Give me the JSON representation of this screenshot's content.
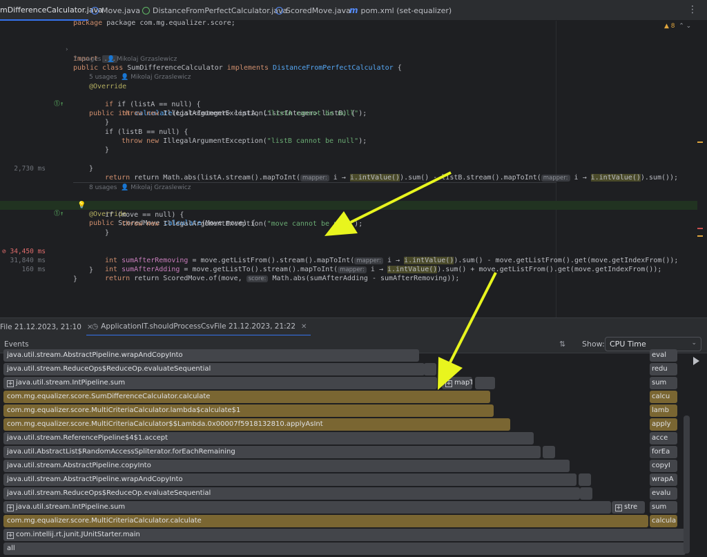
{
  "tabs": [
    {
      "label": "mDifferenceCalculator.java",
      "icon": "class-icon",
      "active": true
    },
    {
      "label": "Move.java",
      "icon": "class-icon"
    },
    {
      "label": "DistanceFromPerfectCalculator.java",
      "icon": "interface-icon"
    },
    {
      "label": "ScoredMove.java",
      "icon": "record-icon"
    },
    {
      "label": "pom.xml (set-equalizer)",
      "icon": "maven-icon"
    }
  ],
  "tabs_more": "⋮",
  "editor": {
    "warning_count": "8",
    "package_line": "package com.mg.equalizer.score;",
    "import_kw": "import",
    "import_fold": "...",
    "hint1_usages": "7 usages",
    "hint1_author": "Mikolaj Grzaslewicz",
    "class_kw": "public class",
    "class_name": "SumDifferenceCalculator",
    "implements_kw": "implements",
    "iface_name": "DistanceFromPerfectCalculator",
    "open_brace": "{",
    "hint2_usages": "5 usages",
    "hint2_author": "Mikolaj Grzaslewicz",
    "override1": "@Override",
    "m1_kw": "public int",
    "m1_name": "calculate",
    "m1_params": "(List<Integer> listA, List<Integer> listB) {",
    "if_a": "if (listA == null) {",
    "throw_a_kw": "throw new",
    "throw_a_cls": "IllegalArgumentException(",
    "throw_a_str": "\"listA cannot be null\"",
    "throw_end": ");",
    "close": "}",
    "if_b": "if (listB == null) {",
    "throw_b_str": "\"listB cannot be null\"",
    "return1_a": "return Math.abs(listA.stream().mapToInt(",
    "mapper": "mapper:",
    "lambda_var": "i → ",
    "int_value": "i.intValue()",
    "return1_b": ").sum() - listB.stream().mapToInt(",
    "return1_c": ").sum());",
    "ms_return1": "2,730 ms",
    "hint3_usages": "8 usages",
    "hint3_author": "Mikolaj Grzaslewicz",
    "override2": "@Override",
    "m2_kw": "public",
    "m2_type": "ScoredMove",
    "m2_name": "calculate",
    "m2_params": "(Move move) {",
    "if_move": "if (move == null) {",
    "throw_move_str": "\"move cannot be null\"",
    "int_kw": "int",
    "removing_var": "sumAfterRemoving",
    "removing_a": " = move.getListFrom().stream().mapToInt(",
    "removing_b": ").sum() - move.getListFrom().get(move.getIndexFrom());",
    "adding_var": "sumAfterAdding",
    "adding_a": " = move.getListTo().stream().mapToInt(",
    "adding_b": ").sum() + move.getListFrom().get(move.getIndexFrom());",
    "return2_a": "return ScoredMove.of(move, ",
    "score": "score:",
    "return2_b": "Math.abs(sumAfterAdding - sumAfterRemoving));",
    "ms_removing": "34,450 ms",
    "ms_adding": "31,840 ms",
    "ms_return2": "160 ms"
  },
  "profiler": {
    "tab1": "File 21.12.2023, 21:10",
    "tab2": "ApplicationIT.shouldProcessCsvFile 21.12.2023, 21:22",
    "close_x": "✕",
    "events_label": "Events",
    "show_label": "Show:",
    "show_value": "CPU Time",
    "frames": [
      {
        "label": "java.util.stream.AbstractPipeline.wrapAndCopyInto",
        "color": "gray",
        "side": "eval"
      },
      {
        "label": "java.util.stream.ReduceOps$ReduceOp.evaluateSequential",
        "color": "gray",
        "side": "redu"
      },
      {
        "label": "java.util.stream.IntPipeline.sum",
        "color": "gray",
        "expand": true,
        "extra": "mapTo",
        "side": "sum"
      },
      {
        "label": "com.mg.equalizer.score.SumDifferenceCalculator.calculate",
        "color": "gold",
        "side": "calcu"
      },
      {
        "label": "com.mg.equalizer.score.MultiCriteriaCalculator.lambda$calculate$1",
        "color": "gold",
        "side": "lamb"
      },
      {
        "label": "com.mg.equalizer.score.MultiCriteriaCalculator$$Lambda.0x00007f5918132810.applyAsInt",
        "color": "gold",
        "side": "apply"
      },
      {
        "label": "java.util.stream.ReferencePipeline$4$1.accept",
        "color": "gray",
        "side": "acce"
      },
      {
        "label": "java.util.AbstractList$RandomAccessSpliterator.forEachRemaining",
        "color": "gray",
        "side": "forEa"
      },
      {
        "label": "java.util.stream.AbstractPipeline.copyInto",
        "color": "gray",
        "side": "copyI"
      },
      {
        "label": "java.util.stream.AbstractPipeline.wrapAndCopyInto",
        "color": "gray",
        "side": "wrapA"
      },
      {
        "label": "java.util.stream.ReduceOps$ReduceOp.evaluateSequential",
        "color": "gray",
        "side": "evalu"
      },
      {
        "label": "java.util.stream.IntPipeline.sum",
        "color": "gray",
        "expand": true,
        "extra": "stre",
        "side": "sum"
      },
      {
        "label": "com.mg.equalizer.score.MultiCriteriaCalculator.calculate",
        "color": "gold",
        "side": "calcula"
      },
      {
        "label": "com.intellij.rt.junit.JUnitStarter.main",
        "color": "gray",
        "expand": true
      },
      {
        "label": "all",
        "color": "gray"
      }
    ]
  },
  "colors": {
    "accent": "#3574f0",
    "frame_gold": "#7a6632",
    "frame_gray": "#43454a",
    "arrow": "#e8f51e"
  }
}
